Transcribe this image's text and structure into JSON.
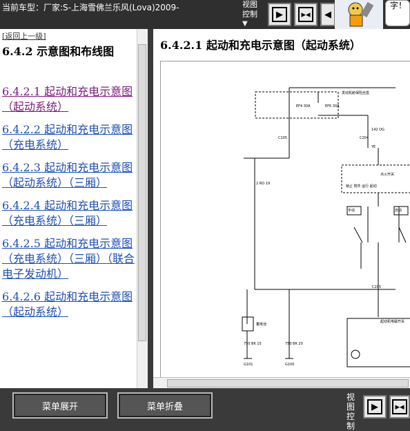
{
  "header": {
    "vehicle_label": "当前车型：厂家:S-上海雪佛兰乐风(Lova)2009-",
    "view_control": "视图控制",
    "mascot_text": "字！"
  },
  "toc": {
    "back_link": "[返回上一级]",
    "section_title": "6.4.2 示意图和布线图",
    "items": [
      {
        "label": "6.4.2.1 起动和充电示意图（起动系统）",
        "active": true
      },
      {
        "label": "6.4.2.2 起动和充电示意图（充电系统）",
        "active": false
      },
      {
        "label": "6.4.2.3 起动和充电示意图（起动系统）（三厢）",
        "active": false
      },
      {
        "label": "6.4.2.4 起动和充电示意图（充电系统）（三厢）",
        "active": false
      },
      {
        "label": "6.4.2.5 起动和充电示意图（充电系统）（三厢）（联合电子发动机）",
        "active": false
      },
      {
        "label": "6.4.2.6 起动和充电示意图（起动系统）",
        "active": false
      }
    ]
  },
  "content": {
    "title": "6.4.2.1 起动和充电示意图（起动系统）",
    "diagram_labels": {
      "fuse_box": "发动机舱保险丝盒",
      "fuse_ef4": "EF4 30A",
      "fuse_ef6": "EF6 30A",
      "c105": "C105",
      "c204": "C204",
      "c205": "C205",
      "wire_142_og": "142 OG 3",
      "wire_2_rd": "2 RD 19",
      "wire_ye": "YE",
      "switch_label": "点火开关",
      "battery_label": "蓄电池",
      "starter_label": "起动机电磁开关",
      "ground_g101": "G101",
      "ground_g100": "G100",
      "wire_750_bk_15": "750 BK 15",
      "wire_750_bk_20": "750 BK 20",
      "pos_lock": "锁止",
      "pos_acc": "附件",
      "pos_on": "运行",
      "pos_start": "起动",
      "manual": "手动变速器",
      "auto": "自动变速器",
      "clutch_switch": "离合器踏板开关",
      "neutral": "空档开关"
    }
  },
  "bottom": {
    "expand_button": "菜单展开",
    "collapse_button": "菜单折叠",
    "view_control": "视图控制"
  },
  "colors": {
    "link": "#1d4fb4",
    "visited_link": "#7c1b7c",
    "toolbar_bg": "#3a3a3a"
  }
}
